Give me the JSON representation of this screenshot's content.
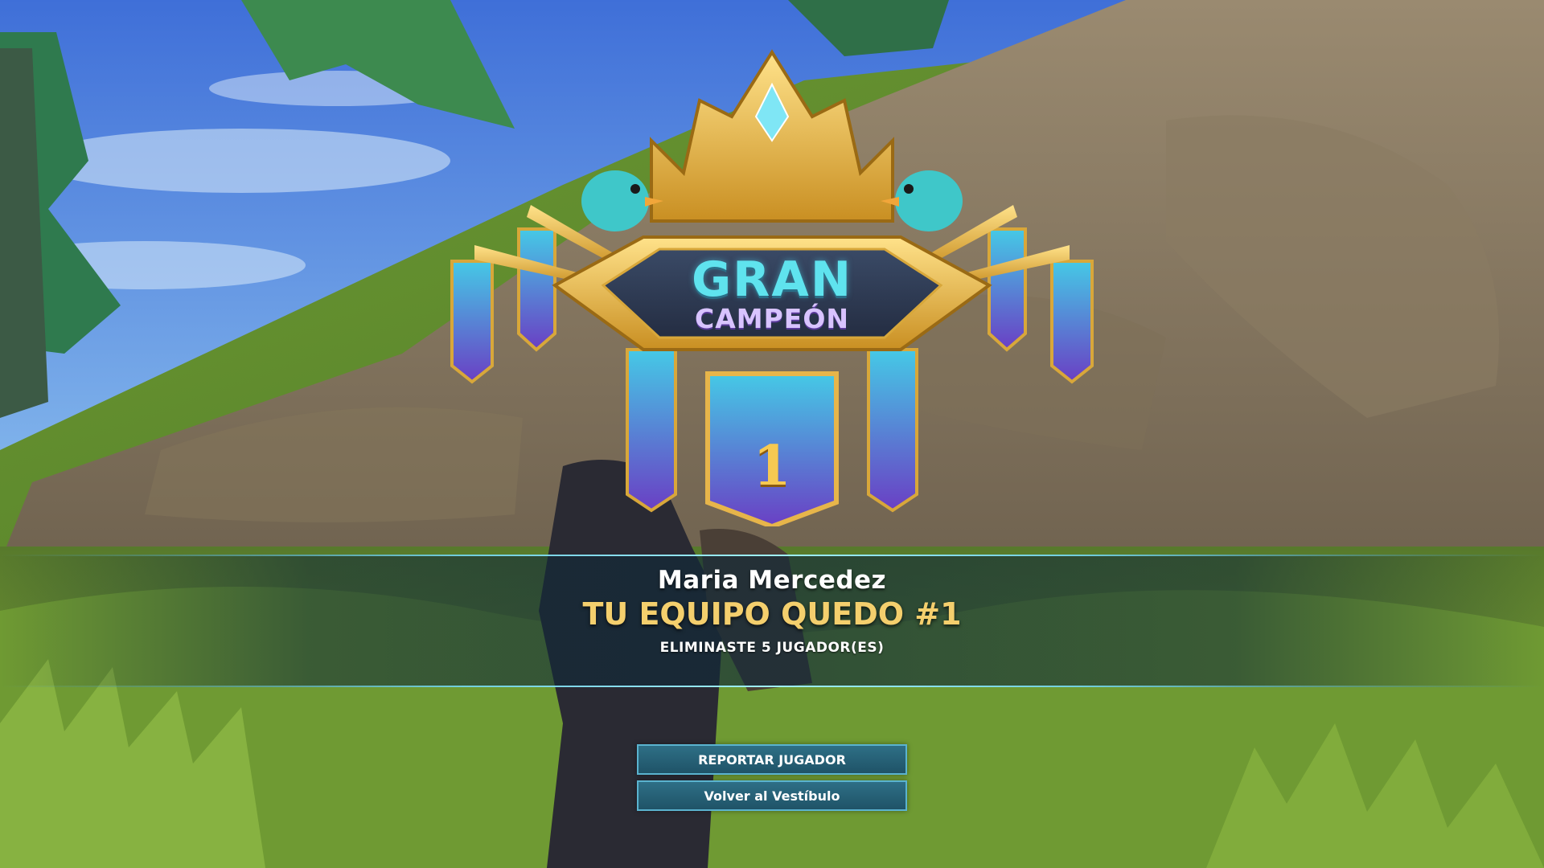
{
  "emblem": {
    "title_line1": "GRAN",
    "title_line2": "CAMPEÓN",
    "rank_number": "1"
  },
  "result": {
    "player_name": "Maria Mercedez",
    "placement": "TU EQUIPO QUEDO #1",
    "eliminations": "ELIMINASTE 5 JUGADOR(ES)"
  },
  "buttons": {
    "report_player": "REPORTAR JUGADOR",
    "back_to_lobby": "Volver al Vestíbulo"
  },
  "colors": {
    "title_gold": "#f4cf6d",
    "button_fill": "#2e6f86",
    "button_border": "#5ab3cf",
    "emblem_cyan": "#5fe3ee",
    "emblem_purple": "#d8c3ff"
  }
}
